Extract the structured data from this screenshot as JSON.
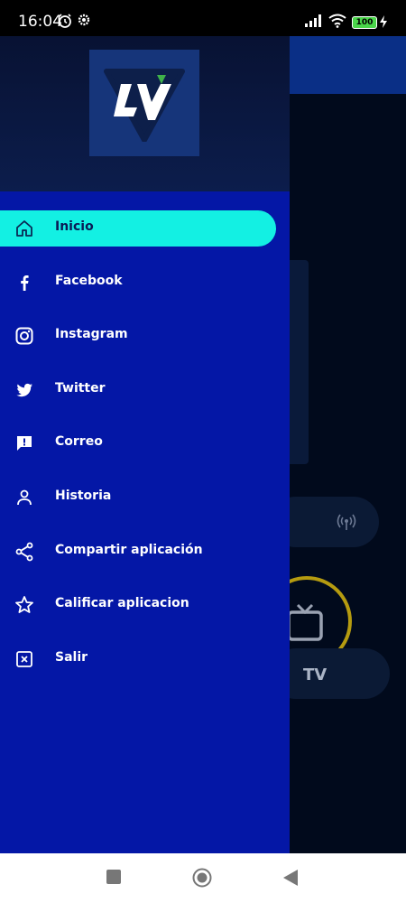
{
  "status_bar": {
    "time": "16:04",
    "battery": "100"
  },
  "drawer": {
    "menu": [
      {
        "label": "Inicio",
        "icon": "home-icon",
        "active": true
      },
      {
        "label": "Facebook",
        "icon": "facebook-icon"
      },
      {
        "label": "Instagram",
        "icon": "instagram-icon"
      },
      {
        "label": "Twitter",
        "icon": "twitter-icon"
      },
      {
        "label": "Correo",
        "icon": "feedback-icon"
      },
      {
        "label": "Historia",
        "icon": "person-icon"
      },
      {
        "label": "Compartir aplicación",
        "icon": "share-icon"
      },
      {
        "label": "Calificar aplicacion",
        "icon": "star-icon"
      },
      {
        "label": "Salir",
        "icon": "exit-icon"
      }
    ]
  },
  "background": {
    "tv_label": "TV"
  },
  "colors": {
    "drawer_bg": "#0417a6",
    "active_item": "#13f0e3",
    "accent_ring": "#b59b10"
  }
}
